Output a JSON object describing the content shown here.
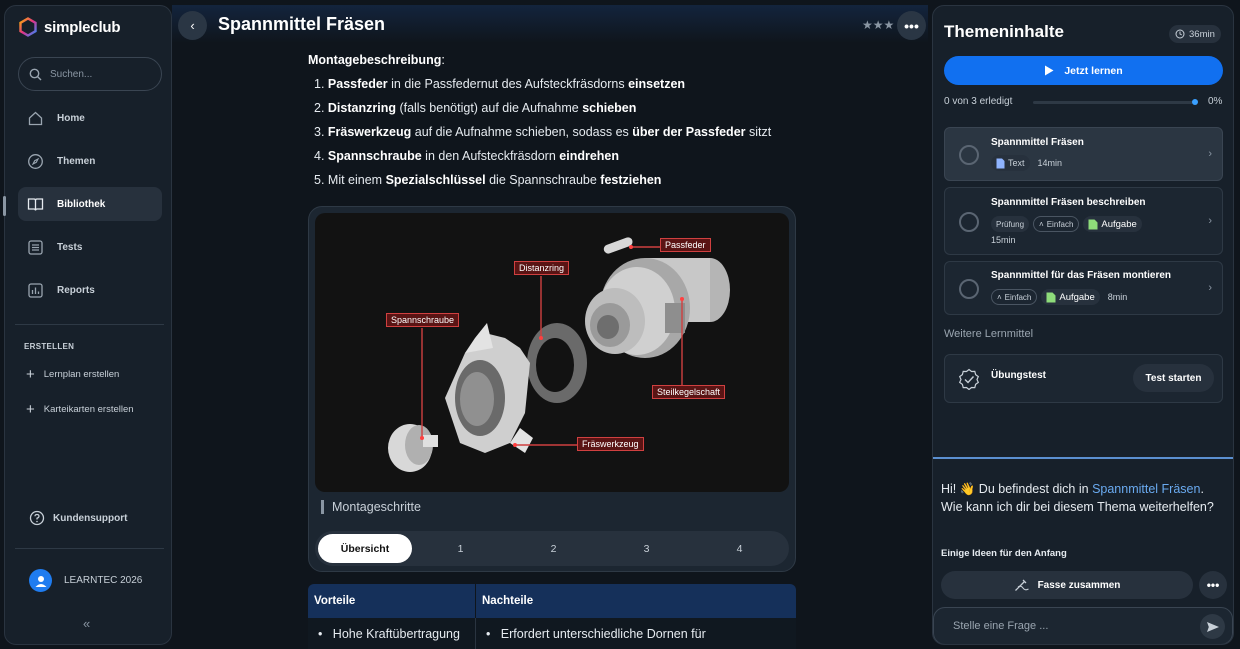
{
  "app": {
    "brand": "simpleclub"
  },
  "sidebar": {
    "search_placeholder": "Suchen...",
    "items": [
      {
        "label": "Home",
        "icon": "home-icon"
      },
      {
        "label": "Themen",
        "icon": "compass-icon"
      },
      {
        "label": "Bibliothek",
        "icon": "book-icon",
        "active": true
      },
      {
        "label": "Tests",
        "icon": "list-icon"
      },
      {
        "label": "Reports",
        "icon": "chart-icon"
      }
    ],
    "create_section": "ERSTELLEN",
    "create_items": [
      "Lernplan erstellen",
      "Karteikarten erstellen"
    ],
    "support": "Kundensupport",
    "user_name": "LEARNTEC 2026"
  },
  "header": {
    "title": "Spannmittel Fräsen"
  },
  "content": {
    "heading": "Montagebeschreibung",
    "heading_suffix": ":",
    "steps": [
      [
        "Passfeder",
        " in die Passfedernut des Aufsteckfräsdorns ",
        "einsetzen",
        ""
      ],
      [
        "Distanzring",
        " (falls benötigt) auf die Aufnahme ",
        "schieben",
        ""
      ],
      [
        "Fräswerkzeug",
        " auf die Aufnahme schieben, sodass es ",
        "über der Passfeder",
        " sitzt"
      ],
      [
        "Spannschraube",
        " in den Aufsteckfräsdorn ",
        "eindrehen",
        ""
      ],
      [
        "",
        "Mit einem ",
        "Spezialschlüssel",
        " die Spannschraube ",
        "festziehen"
      ]
    ],
    "figure": {
      "callouts": [
        "Passfeder",
        "Distanzring",
        "Spannschraube",
        "Steilkegelschaft",
        "Fräswerkzeug"
      ],
      "caption": "Montageschritte",
      "tabs": [
        "Übersicht",
        "1",
        "2",
        "3",
        "4"
      ]
    },
    "table": {
      "headers": [
        "Vorteile",
        "Nachteile"
      ],
      "row": [
        "Hohe Kraftübertragung",
        "Erfordert unterschiedliche Dornen für"
      ]
    }
  },
  "right_panel": {
    "title": "Themeninhalte",
    "duration": "36min",
    "learn_button": "Jetzt lernen",
    "progress_text": "0 von 3 erledigt",
    "progress_percent": "0%",
    "progress_value": 0,
    "lessons": [
      {
        "title": "Spannmittel Fräsen",
        "type": "Text",
        "duration": "14min"
      },
      {
        "title": "Spannmittel Fräsen beschreiben",
        "tag1": "Prüfung",
        "tag2": "Einfach",
        "type": "Aufgabe",
        "duration": "15min"
      },
      {
        "title": "Spannmittel für das Fräsen montieren",
        "tag2": "Einfach",
        "type": "Aufgabe",
        "duration": "8min"
      }
    ],
    "further_label": "Weitere Lernmittel",
    "test_name": "Übungstest",
    "test_button": "Test starten",
    "chat": {
      "greeting": "Hi! 👋 Du befindest dich in ",
      "topic_link": "Spannmittel Fräsen",
      "greeting_end": ". Wie kann ich dir bei diesem Thema weiterhelfen?",
      "ideas_label": "Einige Ideen für den Anfang",
      "summarize": "Fasse zusammen",
      "input_placeholder": "Stelle eine Frage ..."
    }
  },
  "colors": {
    "accent": "#1170f0",
    "callout_border": "#d04040",
    "table_header": "#15305a"
  }
}
